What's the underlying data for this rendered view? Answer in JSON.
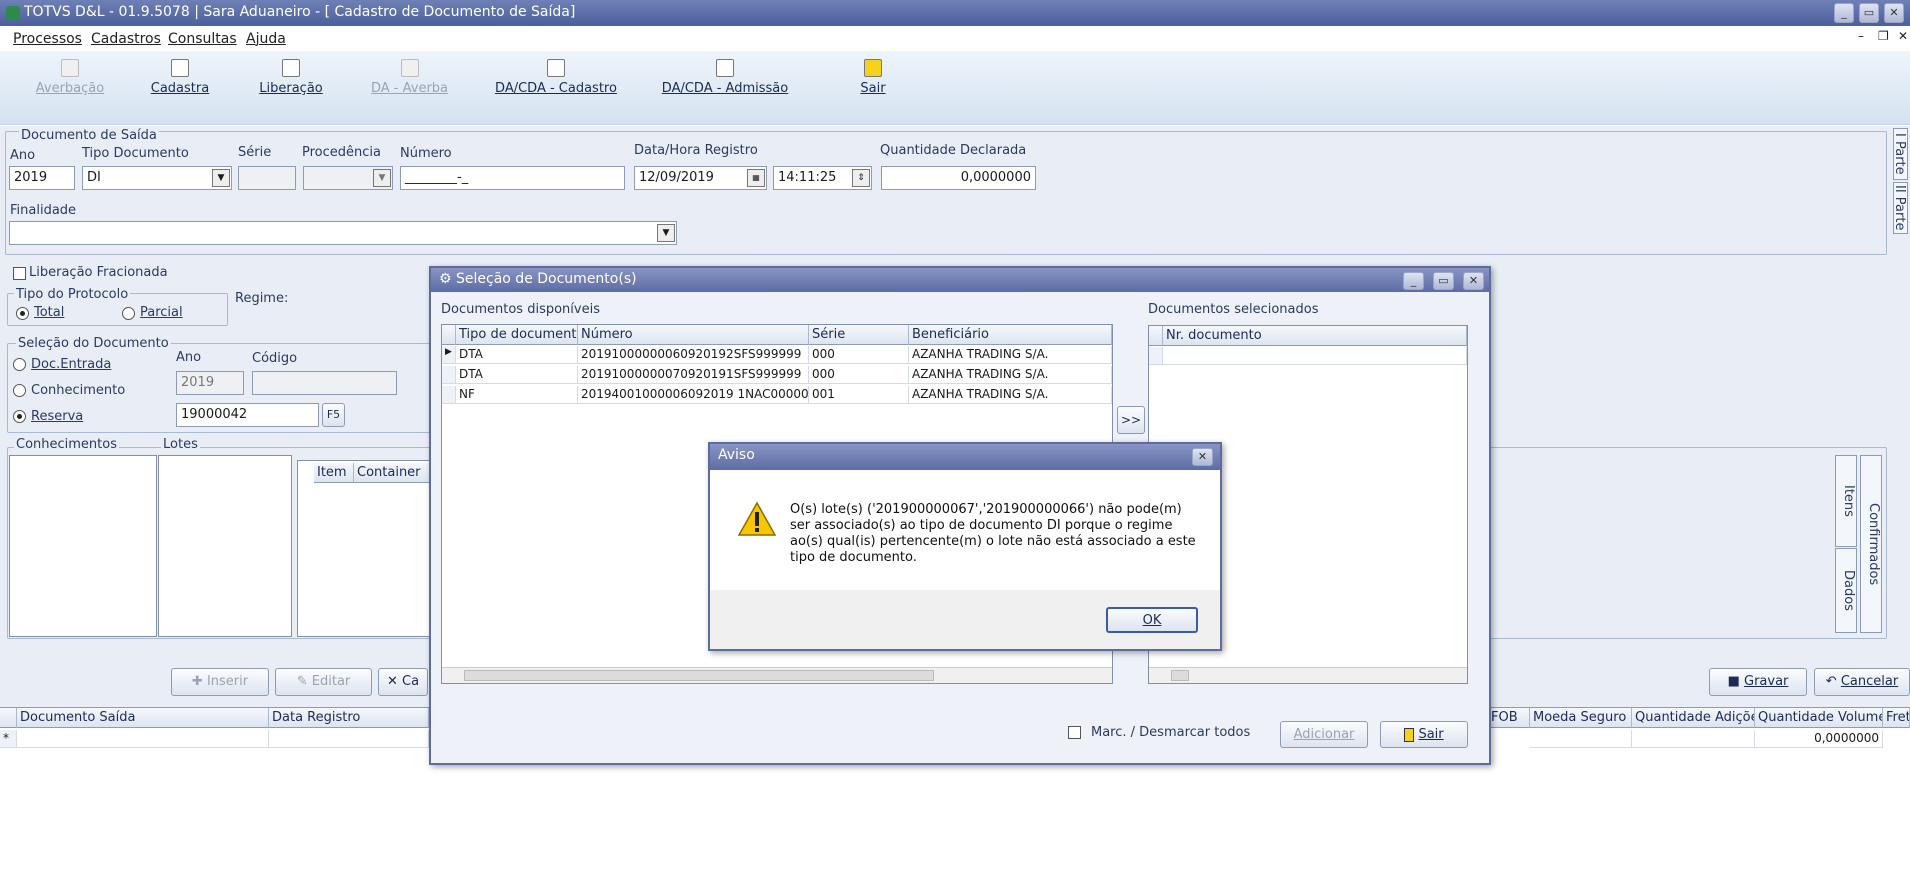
{
  "window": {
    "title": "TOTVS D&L - 01.9.5078 | Sara Aduaneiro - [ Cadastro de Documento de Saída]"
  },
  "menu": [
    "Processos",
    "Cadastros",
    "Consultas",
    "Ajuda"
  ],
  "toolbar": {
    "averbacao": "Averbação",
    "cadastra": "Cadastra",
    "liberacao": "Liberação",
    "da_averba": "DA - Averba",
    "dacda_cadastro": "DA/CDA - Cadastro",
    "dacda_admissao": "DA/CDA - Admissão",
    "sair": "Sair"
  },
  "documento_saida": {
    "legend": "Documento de Saída",
    "ano_label": "Ano",
    "ano": "2019",
    "tipo_label": "Tipo Documento",
    "tipo": "DI",
    "serie_label": "Série",
    "procedencia_label": "Procedência",
    "numero_label": "Número",
    "numero": "________-_",
    "data_label": "Data/Hora Registro",
    "data": "12/09/2019",
    "hora": "14:11:25",
    "qtd_label": "Quantidade Declarada",
    "qtd": "0,0000000",
    "finalidade_label": "Finalidade"
  },
  "liberacao_fracionada": "Liberação Fracionada",
  "protocolo": {
    "legend": "Tipo do Protocolo",
    "total": "Total",
    "parcial": "Parcial",
    "regime": "Regime:"
  },
  "selecao": {
    "legend": "Seleção do Documento",
    "doc_entrada": "Doc.Entrada",
    "conhecimento": "Conhecimento",
    "reserva": "Reserva",
    "ano_label": "Ano",
    "codigo_label": "Código",
    "ano": "2019",
    "reserva_value": "19000042",
    "f5": "F5"
  },
  "lists": {
    "conhecimentos": "Conhecimentos",
    "lotes": "Lotes",
    "item": "Item",
    "container": "Container"
  },
  "side_tabs": {
    "i_parte": "I Parte",
    "ii_parte": "II Parte",
    "itens": "Itens",
    "dados": "Dados",
    "confirmados": "Confirmados"
  },
  "actions": {
    "inserir": "Inserir",
    "editar": "Editar",
    "cancelar_short": "Ca",
    "gravar": "Gravar",
    "cancelar": "Cancelar"
  },
  "bottom_grid": {
    "left_headers": [
      "Documento Saída",
      "Data Registro"
    ],
    "right_headers": [
      "FOB",
      "Moeda Seguro",
      "Quantidade Adições",
      "Quantidade Volumes",
      "Frete"
    ],
    "new_row_marker": "*",
    "qtd_volumes": "0,0000000"
  },
  "selecao_dialog": {
    "title": "Seleção de Documento(s)",
    "disponiveis_label": "Documentos disponíveis",
    "selecionados_label": "Documentos selecionados",
    "headers": [
      "Tipo de documento",
      "Número",
      "Série",
      "Beneficiário"
    ],
    "rows": [
      [
        "DTA",
        "20191000000060920192SFS999999",
        "000",
        "AZANHA TRADING S/A."
      ],
      [
        "DTA",
        "20191000000070920191SFS999999",
        "000",
        "AZANHA TRADING S/A."
      ],
      [
        "NF",
        "20194001000006092019 1NAC00000",
        "001",
        "AZANHA TRADING S/A."
      ]
    ],
    "sel_header": "Nr. documento",
    "move_btn": ">>",
    "marcar": "Marc. / Desmarcar todos",
    "adicionar": "Adicionar",
    "sair": "Sair"
  },
  "aviso": {
    "title": "Aviso",
    "message": "O(s) lote(s) ('201900000067','201900000066') não pode(m) ser associado(s) ao tipo de documento DI porque o regime ao(s) qual(is) pertencente(m) o lote não está associado a este tipo de documento.",
    "ok": "OK"
  }
}
